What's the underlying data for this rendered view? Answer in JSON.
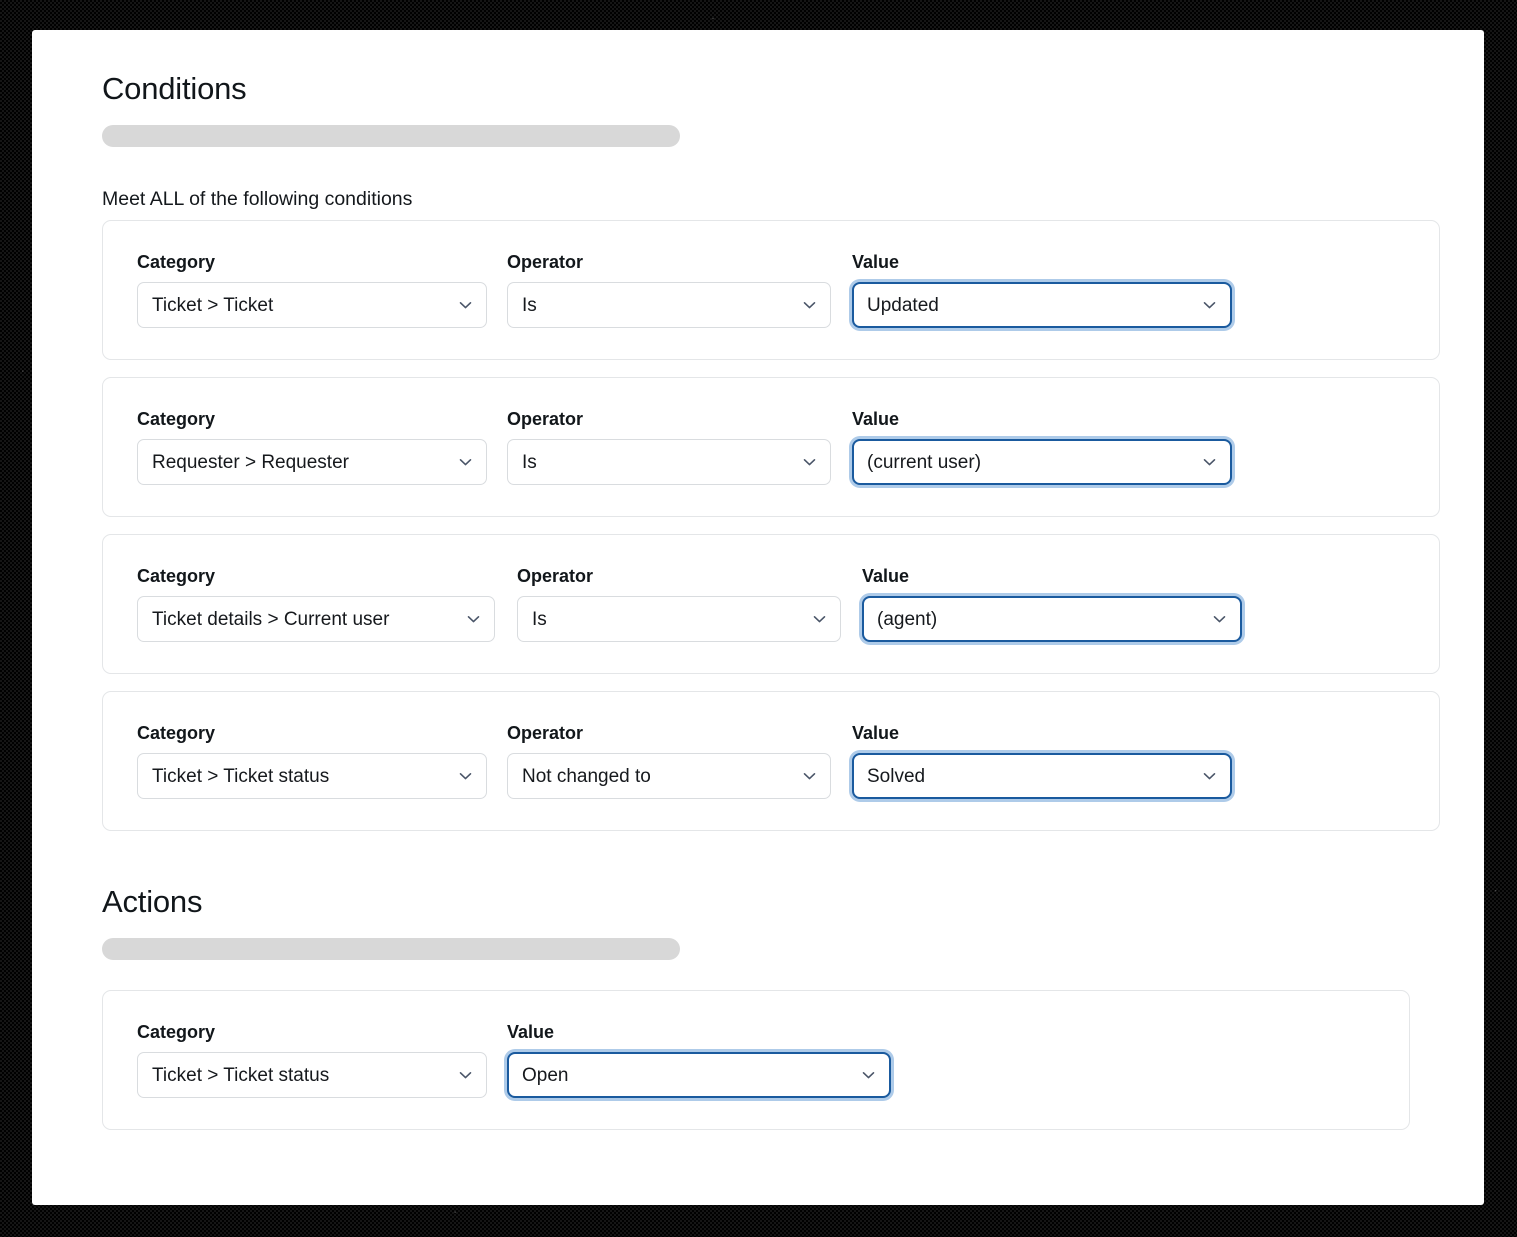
{
  "conditions": {
    "heading": "Conditions",
    "match_label": "Meet ALL of the following conditions",
    "rows": [
      {
        "category_label": "Category",
        "category_value": "Ticket > Ticket",
        "operator_label": "Operator",
        "operator_value": "Is",
        "value_label": "Value",
        "value_value": "Updated",
        "value_focused": true
      },
      {
        "category_label": "Category",
        "category_value": "Requester > Requester",
        "operator_label": "Operator",
        "operator_value": "Is",
        "value_label": "Value",
        "value_value": "(current user)",
        "value_focused": true
      },
      {
        "category_label": "Category",
        "category_value": "Ticket details > Current user",
        "operator_label": "Operator",
        "operator_value": "Is",
        "value_label": "Value",
        "value_value": "(agent)",
        "value_focused": true
      },
      {
        "category_label": "Category",
        "category_value": "Ticket > Ticket status",
        "operator_label": "Operator",
        "operator_value": "Not changed to",
        "value_label": "Value",
        "value_value": "Solved",
        "value_focused": true
      }
    ]
  },
  "actions": {
    "heading": "Actions",
    "rows": [
      {
        "category_label": "Category",
        "category_value": "Ticket > Ticket status",
        "value_label": "Value",
        "value_value": "Open",
        "value_focused": true
      }
    ]
  },
  "icons": {
    "chevron": "chevron-down-icon"
  },
  "colors": {
    "focus_border": "#1a5a9e",
    "focus_ring": "#aecbe9",
    "card_border": "#e4e6e8",
    "select_border": "#d9dcdf",
    "skeleton": "#d8d8d8",
    "text": "#12171b",
    "chevron": "#4a5568"
  }
}
